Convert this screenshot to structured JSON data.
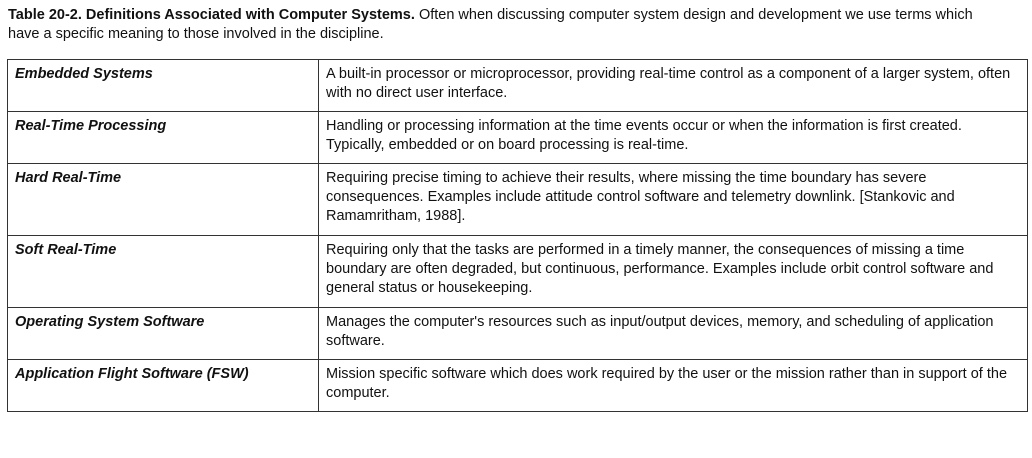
{
  "caption": {
    "title": "Table 20-2. Definitions Associated with Computer Systems.",
    "text": "Often when discussing computer system design and development we use terms which have a specific meaning to those involved in the discipline."
  },
  "rows": [
    {
      "term": "Embedded Systems",
      "definition": "A built-in processor or microprocessor, providing real-time control as a component of a larger system, often with no direct user interface."
    },
    {
      "term": "Real-Time Processing",
      "definition": "Handling or processing information at the time events occur or when the information is first created. Typically, embedded or on board processing is real-time."
    },
    {
      "term": "Hard Real-Time",
      "definition": "Requiring precise timing to achieve their results, where missing the time boundary has severe consequences. Examples include attitude control software and telemetry downlink. [Stankovic and Ramamritham, 1988]."
    },
    {
      "term": "Soft Real-Time",
      "definition": "Requiring only that the tasks are performed in a timely manner, the consequences of missing a time boundary are often degraded, but continuous, performance. Examples include orbit control software and general status or housekeeping."
    },
    {
      "term": "Operating System Software",
      "definition": "Manages the computer's resources such as input/output devices, memory, and scheduling of application software."
    },
    {
      "term": "Application Flight Software (FSW)",
      "definition": "Mission specific software which does work required by the user or the mission rather than in support of the computer."
    }
  ]
}
